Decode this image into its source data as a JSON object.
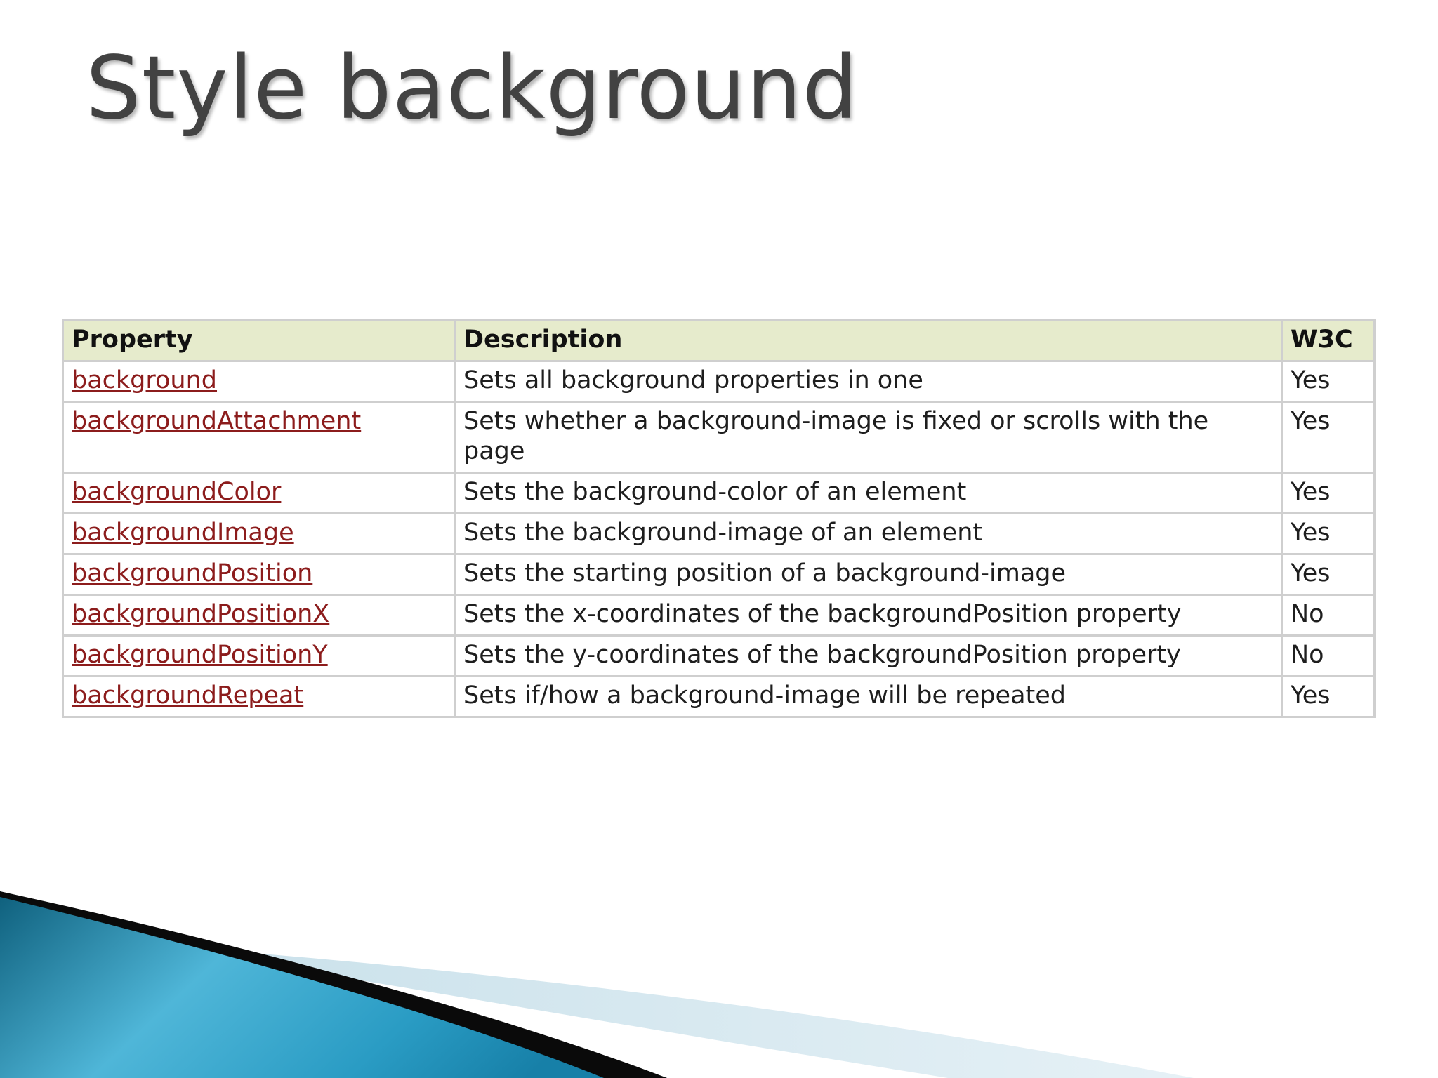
{
  "slide": {
    "title": "Style background"
  },
  "table": {
    "headers": [
      "Property",
      "Description",
      "W3C"
    ],
    "rows": [
      {
        "property": "background",
        "description": "Sets all background properties in one",
        "w3c": "Yes"
      },
      {
        "property": "backgroundAttachment",
        "description": "Sets whether a background-image is fixed or scrolls with the page",
        "w3c": "Yes"
      },
      {
        "property": "backgroundColor",
        "description": "Sets the background-color of an element",
        "w3c": "Yes"
      },
      {
        "property": "backgroundImage",
        "description": "Sets the background-image of an element",
        "w3c": "Yes"
      },
      {
        "property": "backgroundPosition",
        "description": "Sets the starting position of a background-image",
        "w3c": "Yes"
      },
      {
        "property": "backgroundPositionX",
        "description": "Sets the x-coordinates of the backgroundPosition property",
        "w3c": "No"
      },
      {
        "property": "backgroundPositionY",
        "description": "Sets the y-coordinates of the backgroundPosition property",
        "w3c": "No"
      },
      {
        "property": "backgroundRepeat",
        "description": "Sets if/how a background-image will be repeated",
        "w3c": "Yes"
      }
    ]
  },
  "colors": {
    "header_bg": "#e6ebcc",
    "link": "#8c1c1c",
    "title": "#424242",
    "border": "#cfcfcf",
    "accent_blue": "#1f8fb5"
  }
}
